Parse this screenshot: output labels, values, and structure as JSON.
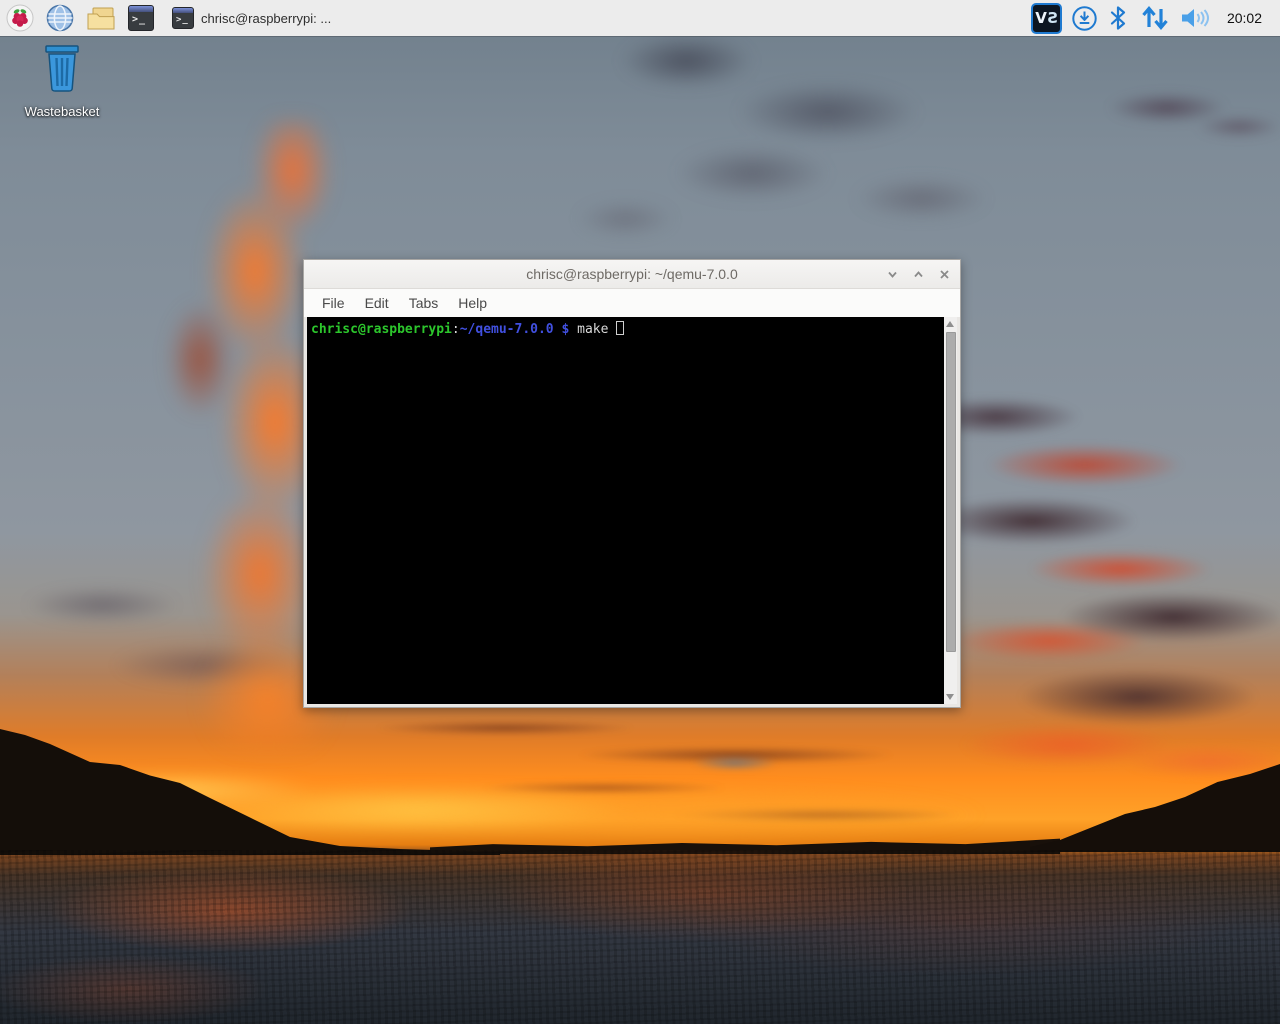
{
  "theme": {
    "taskbar_bg": "#ececec",
    "tray_accent_blue": "#1f7ad0",
    "titlebar_bg": "#f1f0ee",
    "terminal_bg": "#000000",
    "prompt_user_color": "#2cc62c",
    "prompt_path_color": "#4150e0",
    "command_color": "#d9d9d9"
  },
  "taskbar": {
    "launchers": [
      {
        "name": "applications-menu",
        "icon": "raspberry-icon"
      },
      {
        "name": "web-browser",
        "icon": "globe-icon"
      },
      {
        "name": "file-manager",
        "icon": "folder-icon"
      },
      {
        "name": "terminal-launcher",
        "icon": "terminal-icon"
      }
    ],
    "task_button": {
      "label": "chrisc@raspberrypi: ...",
      "icon": "terminal-icon"
    },
    "tray_icons": [
      "vnc-icon",
      "updater-download-icon",
      "bluetooth-icon",
      "network-arrows-icon",
      "volume-icon"
    ],
    "vnc_letters": {
      "v": "V",
      "s": "S"
    },
    "clock": "20:02"
  },
  "desktop": {
    "wastebasket_label": "Wastebasket"
  },
  "window": {
    "title": "chrisc@raspberrypi: ~/qemu-7.0.0",
    "menu": [
      "File",
      "Edit",
      "Tabs",
      "Help"
    ],
    "controls": [
      "minimize",
      "maximize",
      "close"
    ]
  },
  "terminal": {
    "prompt_user": "chrisc@raspberrypi",
    "prompt_separator": ":",
    "prompt_path": "~/qemu-7.0.0",
    "prompt_symbol": " $ ",
    "command": "make"
  }
}
